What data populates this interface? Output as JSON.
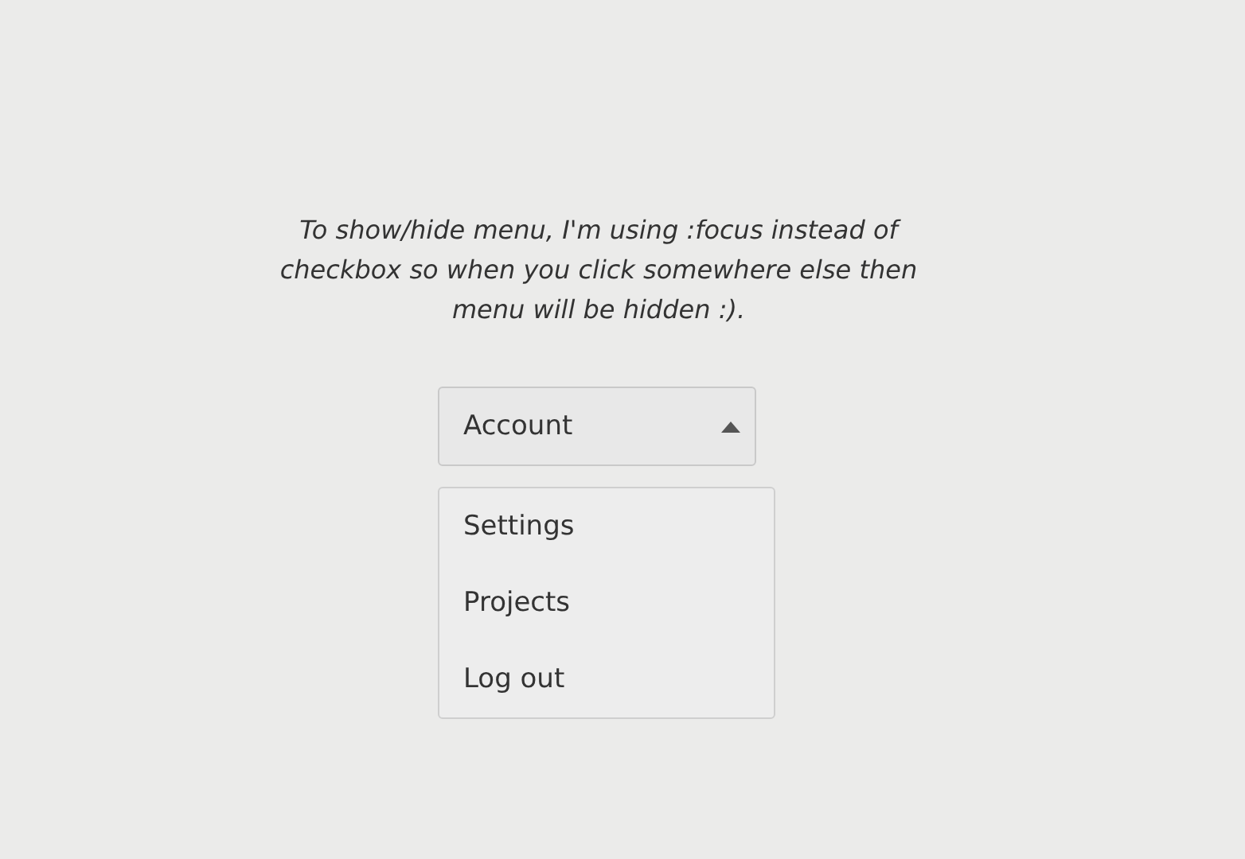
{
  "note": "To show/hide menu, I'm using :focus instead of checkbox so when you click somewhere else then menu will be hidden :).",
  "dropdown": {
    "label": "Account",
    "expanded": true,
    "items": [
      {
        "label": "Settings"
      },
      {
        "label": "Projects"
      },
      {
        "label": "Log out"
      }
    ]
  }
}
